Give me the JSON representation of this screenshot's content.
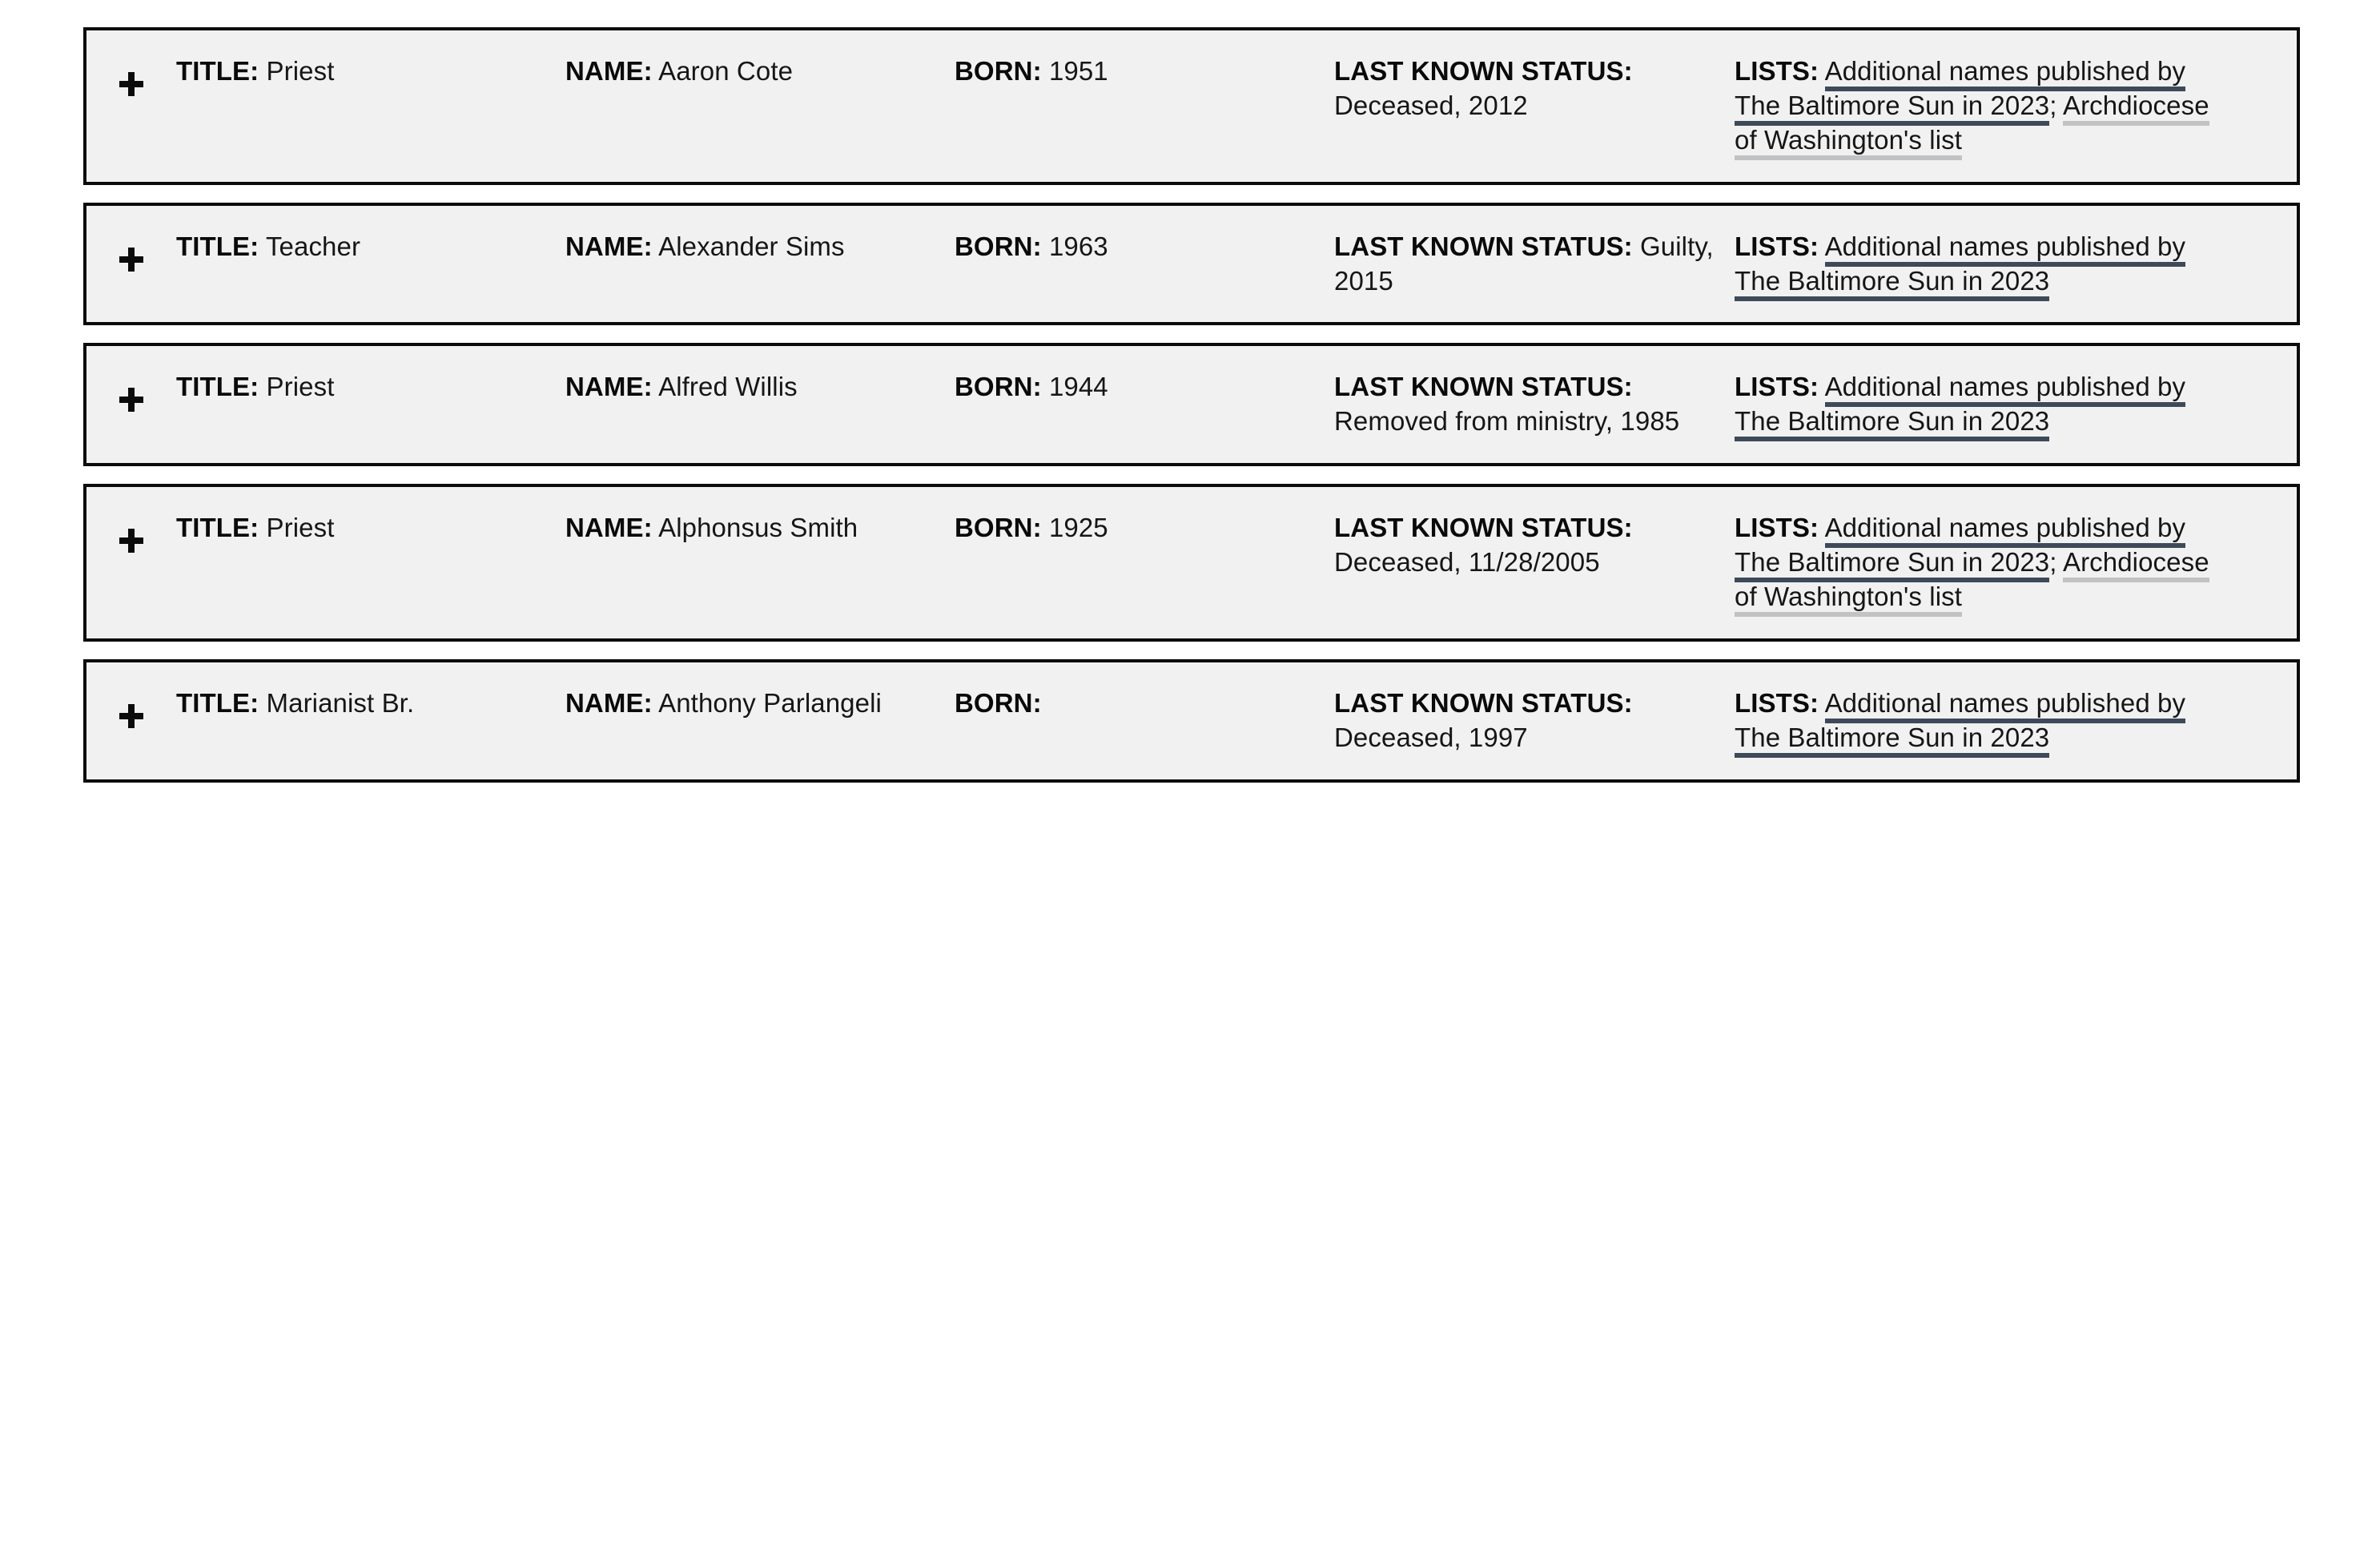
{
  "labels": {
    "title": "TITLE:",
    "name": "NAME:",
    "born": "BORN:",
    "status": "LAST KNOWN STATUS:",
    "lists": "LISTS:"
  },
  "colors": {
    "card_background": "#f1f1f1",
    "card_border": "#0b0b0b",
    "page_background": "#ffffff",
    "primary_link_underline": "#3e4a5a",
    "secondary_link_underline": "#c0c2c4",
    "text": "#161616"
  },
  "icons": {
    "expand": "plus-icon"
  },
  "records": [
    {
      "title": "Priest",
      "name": "Aaron Cote",
      "born": "1951",
      "status": "Deceased, 2012",
      "lists": [
        {
          "label": "Additional names published by The Baltimore Sun in 2023",
          "style": "primary"
        },
        {
          "label": "Archdiocese of Washington's list",
          "style": "secondary"
        }
      ],
      "list_separator": ";"
    },
    {
      "title": "Teacher",
      "name": "Alexander Sims",
      "born": "1963",
      "status": "Guilty, 2015",
      "lists": [
        {
          "label": "Additional names published by The Baltimore Sun in 2023",
          "style": "primary"
        }
      ],
      "list_separator": ";"
    },
    {
      "title": "Priest",
      "name": "Alfred Willis",
      "born": "1944",
      "status": "Removed from ministry, 1985",
      "lists": [
        {
          "label": "Additional names published by The Baltimore Sun in 2023",
          "style": "primary"
        }
      ],
      "list_separator": ";"
    },
    {
      "title": "Priest",
      "name": "Alphonsus Smith",
      "born": "1925",
      "status": "Deceased, 11/28/2005",
      "lists": [
        {
          "label": "Additional names published by The Baltimore Sun in 2023",
          "style": "primary"
        },
        {
          "label": "Archdiocese of Washington's list",
          "style": "secondary"
        }
      ],
      "list_separator": ";"
    },
    {
      "title": "Marianist Br.",
      "name": "Anthony Parlangeli",
      "born": "",
      "status": "Deceased, 1997",
      "lists": [
        {
          "label": "Additional names published by The Baltimore Sun in 2023",
          "style": "primary"
        }
      ],
      "list_separator": ";"
    }
  ]
}
